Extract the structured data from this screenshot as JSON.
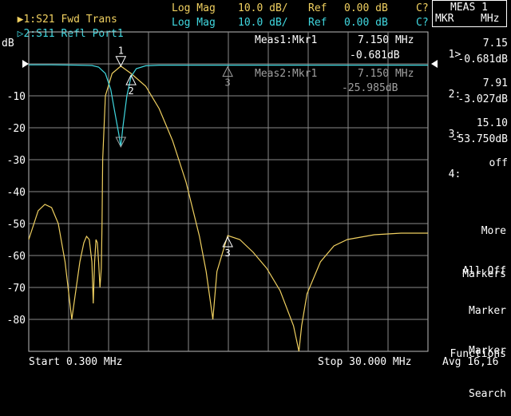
{
  "header": {
    "ch1": {
      "marker": "▶",
      "label": "1:S21 Fwd Trans",
      "format": "Log Mag",
      "scale": "10.0 dB/",
      "ref_label": "Ref",
      "ref_value": "0.00 dB",
      "cal": "C?"
    },
    "ch2": {
      "marker": "▷",
      "label": "2:S11 Refl Port1",
      "format": "Log Mag",
      "scale": "10.0 dB/",
      "ref_label": "Ref",
      "ref_value": "0.00 dB",
      "cal": "C?"
    }
  },
  "menu": {
    "title": "MEAS 1",
    "sub_left": "MKR",
    "sub_right": "MHz",
    "markers": [
      {
        "id": "1>",
        "freq": "7.15",
        "value": "-0.681dB"
      },
      {
        "id": "2:",
        "freq": "7.91",
        "value": "-3.027dB"
      },
      {
        "id": "3:",
        "freq": "15.10",
        "value": "-53.750dB"
      },
      {
        "id": "4:",
        "freq": "off",
        "value": ""
      }
    ],
    "softkeys": {
      "more_markers_1": "More",
      "more_markers_2": "Markers",
      "all_off": "All Off",
      "marker_functions_1": "Marker",
      "marker_functions_2": "Functions",
      "marker_search_1": "Marker",
      "marker_search_2": "Search"
    },
    "avg": "Avg 16,16"
  },
  "plot": {
    "y_unit": "dB",
    "meas1_label": "Meas1:Mkr1",
    "meas1_freq": "7.150 MHz",
    "meas1_value": "-0.681dB",
    "meas2_label": "Meas2:Mkr1",
    "meas2_freq": "7.150 MHz",
    "meas2_value": "-25.985dB",
    "start": "Start 0.300 MHz",
    "stop": "Stop 30.000 MHz"
  },
  "chart_data": {
    "type": "line",
    "x_start_mhz": 0.3,
    "x_stop_mhz": 30.0,
    "ylim": [
      -90,
      10
    ],
    "y_ticks": [
      "-10",
      "-20",
      "-30",
      "-40",
      "-50",
      "-60",
      "-70",
      "-80"
    ],
    "grid": true,
    "series": [
      {
        "name": "S21 Fwd Trans",
        "color": "#f0d060",
        "x": [
          0.3,
          1.0,
          1.5,
          2.0,
          2.5,
          3.0,
          3.5,
          4.1,
          4.4,
          4.6,
          4.8,
          5.0,
          5.1,
          5.2,
          5.3,
          5.4,
          5.5,
          5.6,
          5.7,
          5.75,
          5.8,
          6.0,
          6.5,
          7.15,
          7.91,
          9.0,
          10.0,
          11.0,
          12.0,
          13.0,
          13.5,
          14.0,
          14.3,
          15.1,
          16.0,
          17.0,
          18.0,
          19.0,
          20.0,
          20.4,
          20.6,
          21.0,
          22.0,
          23.0,
          24.0,
          26.0,
          28.0,
          30.0
        ],
        "y": [
          -55,
          -46,
          -44,
          -45,
          -50,
          -62,
          -80,
          -62,
          -56,
          -54,
          -55,
          -62,
          -75,
          -62,
          -55,
          -56,
          -62,
          -70,
          -64,
          -50,
          -30,
          -10,
          -3,
          -0.7,
          -3,
          -7,
          -14,
          -24,
          -37,
          -54,
          -65,
          -80,
          -65,
          -53.75,
          -55,
          -59,
          -64,
          -71,
          -82,
          -90,
          -82,
          -72,
          -62,
          -57,
          -55,
          -53.5,
          -53,
          -53
        ]
      },
      {
        "name": "S11 Refl Port1",
        "color": "#40d8e0",
        "x": [
          0.3,
          2.0,
          4.0,
          5.0,
          5.5,
          6.0,
          6.4,
          6.7,
          7.0,
          7.15,
          7.3,
          7.6,
          7.91,
          8.3,
          9.0,
          10.0,
          12.0,
          15.0,
          20.0,
          25.0,
          30.0
        ],
        "y": [
          -0.3,
          -0.3,
          -0.4,
          -0.5,
          -1,
          -3,
          -8,
          -15,
          -22,
          -26,
          -20,
          -10,
          -4,
          -1.5,
          -0.6,
          -0.4,
          -0.4,
          -0.4,
          -0.4,
          -0.4,
          -0.4
        ]
      }
    ],
    "markers_on_trace": [
      {
        "label": "1",
        "x": 7.15,
        "y_s21": -0.681,
        "y_s11": -25.985
      },
      {
        "label": "2",
        "x": 7.91,
        "y_s21": -3.027
      },
      {
        "label": "3",
        "x": 15.1,
        "y_s21": -53.75
      }
    ]
  }
}
